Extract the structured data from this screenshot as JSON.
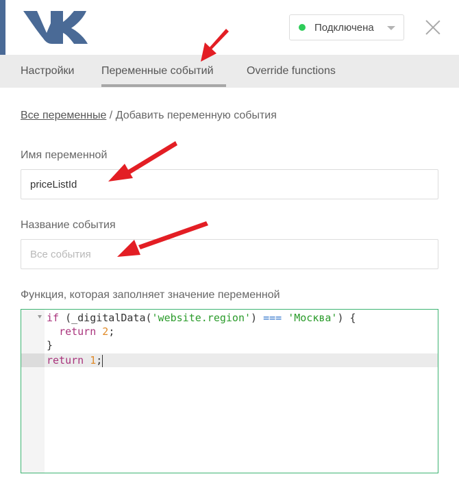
{
  "header": {
    "logo": "vk-logo",
    "status": {
      "label": "Подключена",
      "color": "#2ecc59"
    },
    "close_icon": "close-icon"
  },
  "tabs": [
    {
      "label": "Настройки",
      "active": false
    },
    {
      "label": "Переменные событий",
      "active": true
    },
    {
      "label": "Override functions",
      "active": false
    }
  ],
  "breadcrumb": {
    "link": "Все переменные",
    "separator": " / ",
    "current": "Добавить переменную события"
  },
  "form": {
    "name_label": "Имя переменной",
    "name_value": "priceListId",
    "event_label": "Название события",
    "event_placeholder": "Все события",
    "function_label": "Функция, которая заполняет значение переменной"
  },
  "code": {
    "line1": {
      "kw_if": "if",
      "open": " (_digitalData(",
      "str1": "'website.region'",
      "close1": ") ",
      "op": "===",
      "sp": " ",
      "str2": "'Москва'",
      "close2": ") {"
    },
    "line2": {
      "indent": "  ",
      "kw_return": "return",
      "sp": " ",
      "num": "2",
      "end": ";"
    },
    "line3": {
      "text": "}"
    },
    "line4": {
      "kw_return": "return",
      "sp": " ",
      "num": "1",
      "end": ";"
    }
  },
  "colors": {
    "accent": "#4a6a96",
    "status_green": "#2ecc59",
    "editor_border": "#3cb371",
    "annotation_arrow": "#e31e24"
  }
}
